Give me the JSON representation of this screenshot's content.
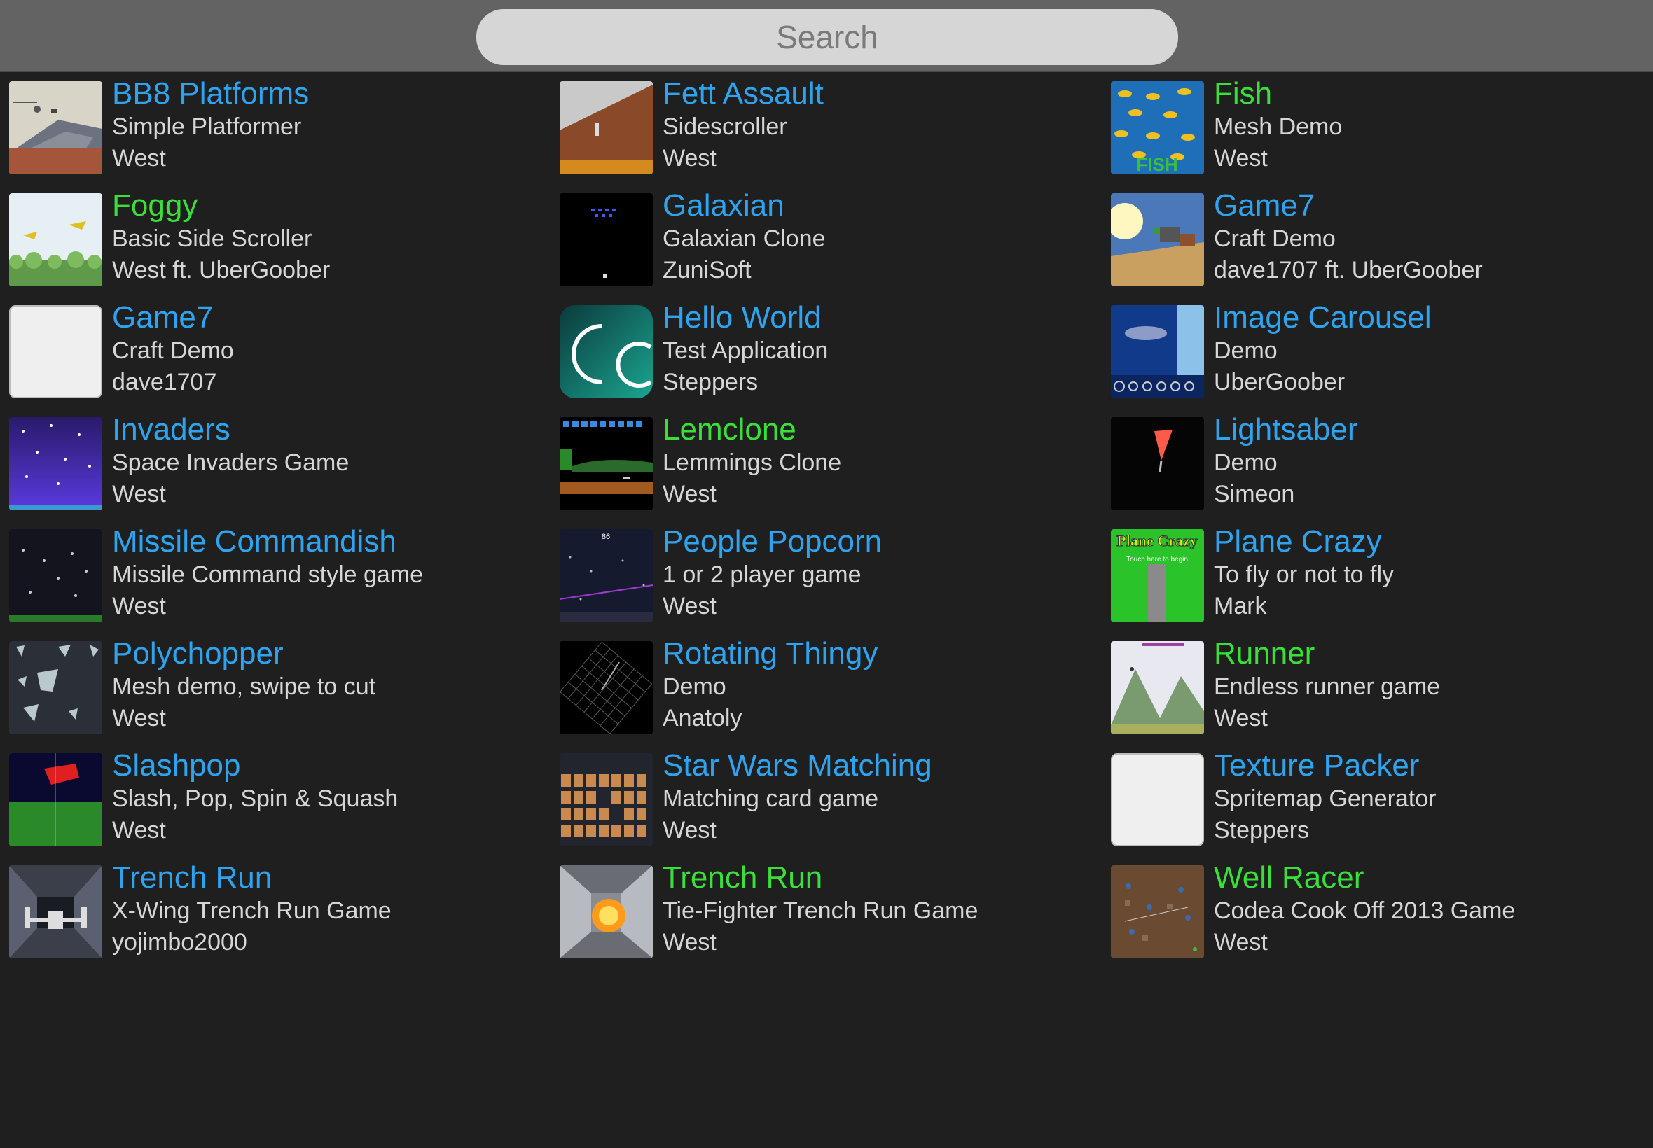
{
  "search": {
    "placeholder": "Search"
  },
  "colors": {
    "title_blue": "#2fa3ee",
    "title_green": "#3bdf3a",
    "text": "#d6d6d6",
    "background": "#1f1f1f",
    "topbar": "#636363"
  },
  "projects": [
    {
      "title": "BB8 Platforms",
      "subtitle": "Simple Platformer",
      "author": "West",
      "highlight": false,
      "thumb": "bb8-platforms-thumbnail"
    },
    {
      "title": "Fett Assault",
      "subtitle": "Sidescroller",
      "author": "West",
      "highlight": false,
      "thumb": "fett-assault-thumbnail"
    },
    {
      "title": "Fish",
      "subtitle": "Mesh Demo",
      "author": "West",
      "highlight": true,
      "thumb": "fish-thumbnail"
    },
    {
      "title": "Foggy",
      "subtitle": "Basic Side Scroller",
      "author": "West ft. UberGoober",
      "highlight": true,
      "thumb": "foggy-thumbnail"
    },
    {
      "title": "Galaxian",
      "subtitle": "Galaxian Clone",
      "author": "ZuniSoft",
      "highlight": false,
      "thumb": "galaxian-thumbnail"
    },
    {
      "title": "Game7",
      "subtitle": "Craft Demo",
      "author": "dave1707 ft. UberGoober",
      "highlight": false,
      "thumb": "game7-craft-thumbnail"
    },
    {
      "title": "Game7",
      "subtitle": "Craft Demo",
      "author": "dave1707",
      "highlight": false,
      "thumb": "blank-thumbnail"
    },
    {
      "title": "Hello World",
      "subtitle": "Test Application",
      "author": "Steppers",
      "highlight": false,
      "thumb": "codea-logo-thumbnail"
    },
    {
      "title": "Image Carousel",
      "subtitle": "Demo",
      "author": "UberGoober",
      "highlight": false,
      "thumb": "image-carousel-thumbnail"
    },
    {
      "title": "Invaders",
      "subtitle": "Space Invaders Game",
      "author": "West",
      "highlight": false,
      "thumb": "invaders-thumbnail"
    },
    {
      "title": "Lemclone",
      "subtitle": "Lemmings Clone",
      "author": "West",
      "highlight": true,
      "thumb": "lemclone-thumbnail"
    },
    {
      "title": "Lightsaber",
      "subtitle": "Demo",
      "author": "Simeon",
      "highlight": false,
      "thumb": "lightsaber-thumbnail"
    },
    {
      "title": "Missile Commandish",
      "subtitle": "Missile Command style game",
      "author": "West",
      "highlight": false,
      "thumb": "missile-commandish-thumbnail"
    },
    {
      "title": "People Popcorn",
      "subtitle": "1 or 2 player game",
      "author": "West",
      "highlight": false,
      "thumb": "people-popcorn-thumbnail"
    },
    {
      "title": "Plane Crazy",
      "subtitle": "To fly or not to fly",
      "author": "Mark",
      "highlight": false,
      "thumb": "plane-crazy-thumbnail"
    },
    {
      "title": "Polychopper",
      "subtitle": "Mesh demo, swipe to cut",
      "author": "West",
      "highlight": false,
      "thumb": "polychopper-thumbnail"
    },
    {
      "title": "Rotating Thingy",
      "subtitle": "Demo",
      "author": "Anatoly",
      "highlight": false,
      "thumb": "rotating-thingy-thumbnail"
    },
    {
      "title": "Runner",
      "subtitle": "Endless runner game",
      "author": "West",
      "highlight": true,
      "thumb": "runner-thumbnail"
    },
    {
      "title": "Slashpop",
      "subtitle": "Slash, Pop, Spin & Squash",
      "author": "West",
      "highlight": false,
      "thumb": "slashpop-thumbnail"
    },
    {
      "title": "Star Wars Matching",
      "subtitle": "Matching card game",
      "author": "West",
      "highlight": false,
      "thumb": "star-wars-matching-thumbnail"
    },
    {
      "title": "Texture Packer",
      "subtitle": "Spritemap Generator",
      "author": "Steppers",
      "highlight": false,
      "thumb": "blank-thumbnail"
    },
    {
      "title": "Trench Run",
      "subtitle": "X-Wing Trench Run Game",
      "author": "yojimbo2000",
      "highlight": false,
      "thumb": "xwing-trench-run-thumbnail"
    },
    {
      "title": "Trench Run",
      "subtitle": "Tie-Fighter Trench Run Game",
      "author": "West",
      "highlight": true,
      "thumb": "tie-fighter-trench-run-thumbnail"
    },
    {
      "title": "Well Racer",
      "subtitle": "Codea Cook Off 2013 Game",
      "author": "West",
      "highlight": true,
      "thumb": "well-racer-thumbnail"
    }
  ],
  "thumb_text": {
    "people_popcorn_score": "86",
    "plane_crazy_title": "Plane Crazy",
    "plane_crazy_tagline": "Touch here to begin",
    "fish_word": "FISH"
  }
}
